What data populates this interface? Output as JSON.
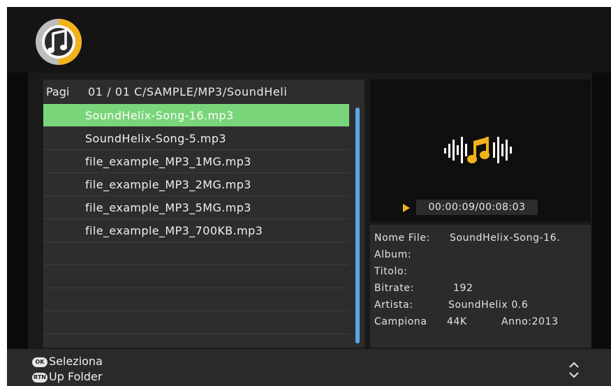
{
  "app": {
    "icon": "music-note-icon",
    "accent": "#f2b21b"
  },
  "browser": {
    "page_label": "Pagi",
    "path": "01 / 01 C/SAMPLE/MP3/SoundHeli",
    "selected_index": 0,
    "selected_color": "#79d579",
    "files": [
      "SoundHelix-Song-16.mp3",
      "SoundHelix-Song-5.mp3",
      "file_example_MP3_1MG.mp3",
      "file_example_MP3_2MG.mp3",
      "file_example_MP3_5MG.mp3",
      "file_example_MP3_700KB.mp3",
      "",
      "",
      "",
      "",
      ""
    ]
  },
  "preview": {
    "icon": "audio-wave-music-note-icon",
    "status_icon": "play-icon",
    "time": "00:00:09/00:08:03"
  },
  "info": {
    "filename_label": "Nome File:",
    "filename_value": "SoundHelix-Song-16.",
    "album_label": "Album:",
    "album_value": "",
    "title_label": "Titolo:",
    "title_value": "",
    "bitrate_label": "Bitrate:",
    "bitrate_value": "192",
    "artist_label": "Artista:",
    "artist_value": "SoundHelix 0.6",
    "sample_label": "Campiona",
    "sample_value": "44K",
    "year": "Anno:2013"
  },
  "footer": {
    "ok_icon_text": "OK",
    "select_label": "Seleziona",
    "rtn_icon_text": "RTN",
    "up_folder_label": "Up Folder",
    "updown_icon": "up-down-arrows-icon"
  }
}
